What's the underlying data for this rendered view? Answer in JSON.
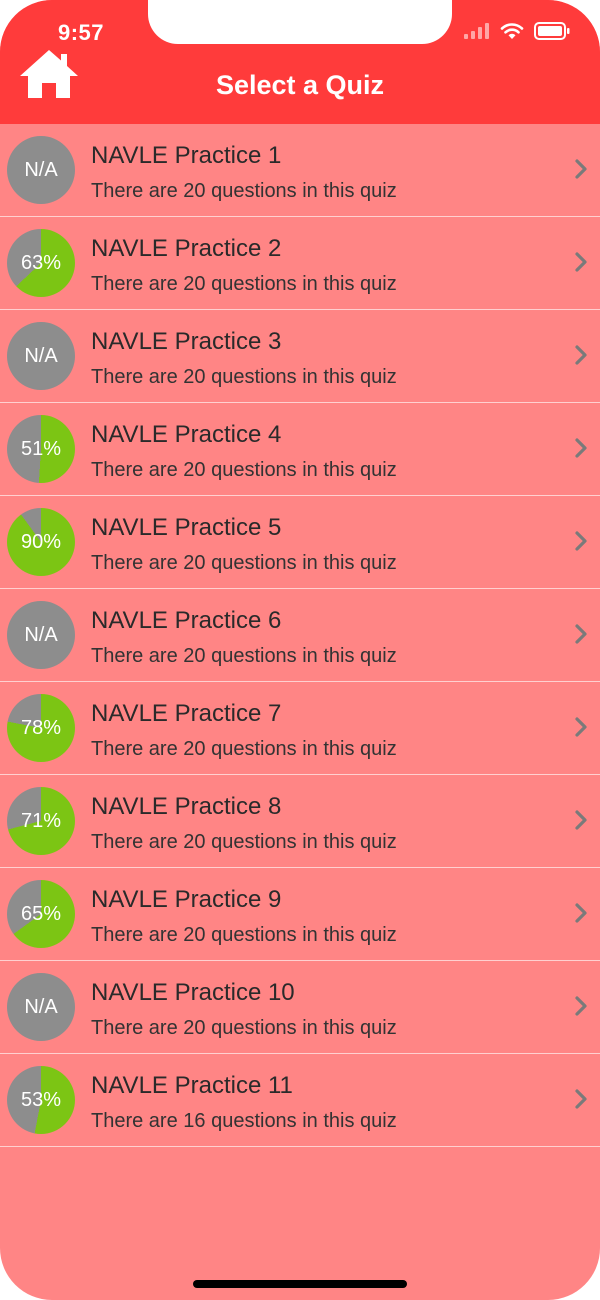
{
  "status": {
    "time": "9:57",
    "icons": [
      "signal-icon",
      "wifi-icon",
      "battery-icon"
    ]
  },
  "header": {
    "title": "Select a Quiz",
    "home_icon": "home-icon"
  },
  "colors": {
    "header": "#ff3b3b",
    "background": "#ff8585",
    "badge_grey": "#8d8d8d",
    "badge_green": "#7cc514"
  },
  "quizzes": [
    {
      "title": "NAVLE Practice 1",
      "subtitle": "There are 20 questions in this quiz",
      "score_label": "N/A",
      "score": null
    },
    {
      "title": "NAVLE Practice 2",
      "subtitle": "There are 20 questions in this quiz",
      "score_label": "63%",
      "score": 63
    },
    {
      "title": "NAVLE Practice 3",
      "subtitle": "There are 20 questions in this quiz",
      "score_label": "N/A",
      "score": null
    },
    {
      "title": "NAVLE Practice 4",
      "subtitle": "There are 20 questions in this quiz",
      "score_label": "51%",
      "score": 51
    },
    {
      "title": "NAVLE Practice 5",
      "subtitle": "There are 20 questions in this quiz",
      "score_label": "90%",
      "score": 90
    },
    {
      "title": "NAVLE Practice 6",
      "subtitle": "There are 20 questions in this quiz",
      "score_label": "N/A",
      "score": null
    },
    {
      "title": "NAVLE Practice 7",
      "subtitle": "There are 20 questions in this quiz",
      "score_label": "78%",
      "score": 78
    },
    {
      "title": "NAVLE Practice 8",
      "subtitle": "There are 20 questions in this quiz",
      "score_label": "71%",
      "score": 71
    },
    {
      "title": "NAVLE Practice 9",
      "subtitle": "There are 20 questions in this quiz",
      "score_label": "65%",
      "score": 65
    },
    {
      "title": "NAVLE Practice 10",
      "subtitle": "There are 20 questions in this quiz",
      "score_label": "N/A",
      "score": null
    },
    {
      "title": "NAVLE Practice 11",
      "subtitle": "There are 16 questions in this quiz",
      "score_label": "53%",
      "score": 53
    }
  ]
}
